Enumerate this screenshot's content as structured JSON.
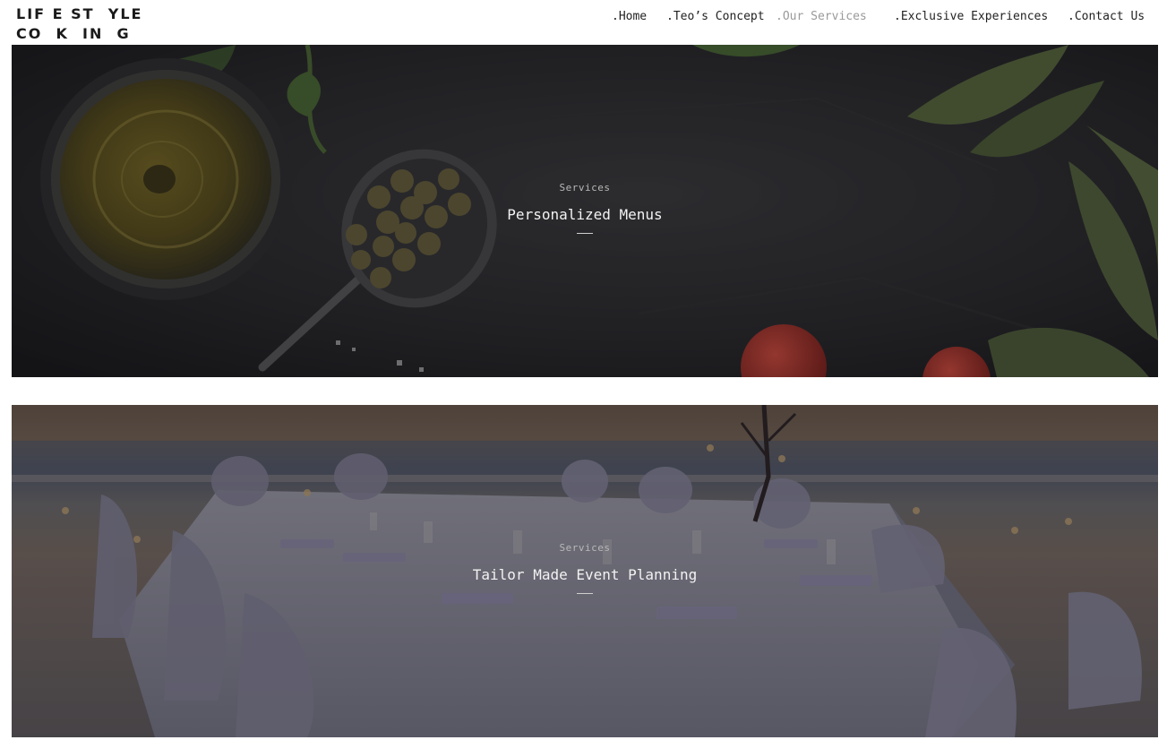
{
  "brand": {
    "logo_line1": "LIF E ST  YLE",
    "logo_line2": "CO  K  IN  G"
  },
  "nav": {
    "items": [
      {
        "label": ".Home",
        "active": false
      },
      {
        "label": ".Teo’s Concept",
        "active": false
      },
      {
        "label": ".Our Services",
        "active": true
      },
      {
        "label": ".Exclusive Experiences",
        "active": false
      },
      {
        "label": ".Contact Us",
        "active": false
      }
    ]
  },
  "services": [
    {
      "kicker": "Services",
      "title": "Personalized Menus",
      "image": "olive-oil-capers-herbs-on-slate"
    },
    {
      "kicker": "Services",
      "title": "Tailor Made Event Planning",
      "image": "beach-banquet-table-at-sunset"
    }
  ],
  "colors": {
    "nav_text": "#222222",
    "nav_active": "#9a9a9a",
    "caption_text": "#f2f2f2"
  }
}
